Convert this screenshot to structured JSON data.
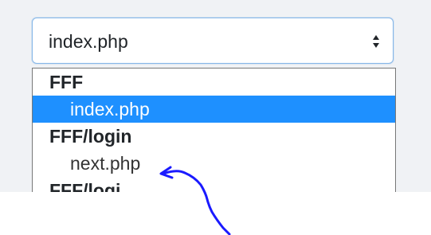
{
  "select": {
    "value": "index.php",
    "arrow_icon": "up-down-chevron-icon"
  },
  "dropdown": {
    "groups": [
      {
        "label": "FFF",
        "options": [
          {
            "label": "index.php",
            "selected": true
          }
        ]
      },
      {
        "label": "FFF/login",
        "options": [
          {
            "label": "next.php",
            "selected": false
          }
        ]
      }
    ],
    "partial_next_group": "FFF/logi..."
  },
  "annotation": {
    "icon": "hand-drawn-arrow-icon",
    "color": "#1a1aff"
  },
  "colors": {
    "selected_bg": "#1e90ff",
    "focus_border": "#86b7e8",
    "page_bg": "#f0f2f5"
  }
}
